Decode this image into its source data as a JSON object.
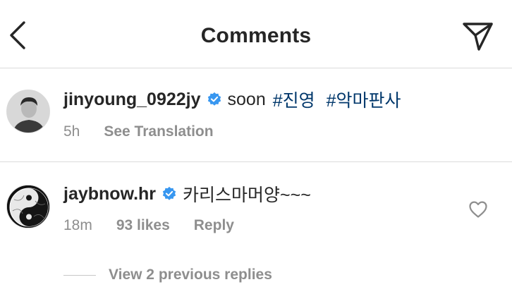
{
  "header": {
    "title": "Comments",
    "back_icon": "chevron-left-icon",
    "send_icon": "paper-plane-icon"
  },
  "caption": {
    "username": "jinyoung_0922jy",
    "verified": true,
    "text": "soon",
    "hashtags": [
      "#진영",
      "#악마판사"
    ],
    "time": "5h",
    "translation_label": "See Translation"
  },
  "comment": {
    "username": "jaybnow.hr",
    "verified": true,
    "text": "카리스마머양~~~",
    "time": "18m",
    "likes": "93 likes",
    "reply_label": "Reply",
    "view_replies": "View 2 previous replies",
    "like_icon": "heart-outline-icon"
  },
  "colors": {
    "text": "#262626",
    "secondary": "#8e8e8e",
    "hashtag": "#00376b",
    "verified": "#3897f0",
    "divider": "#dbdbdb"
  }
}
